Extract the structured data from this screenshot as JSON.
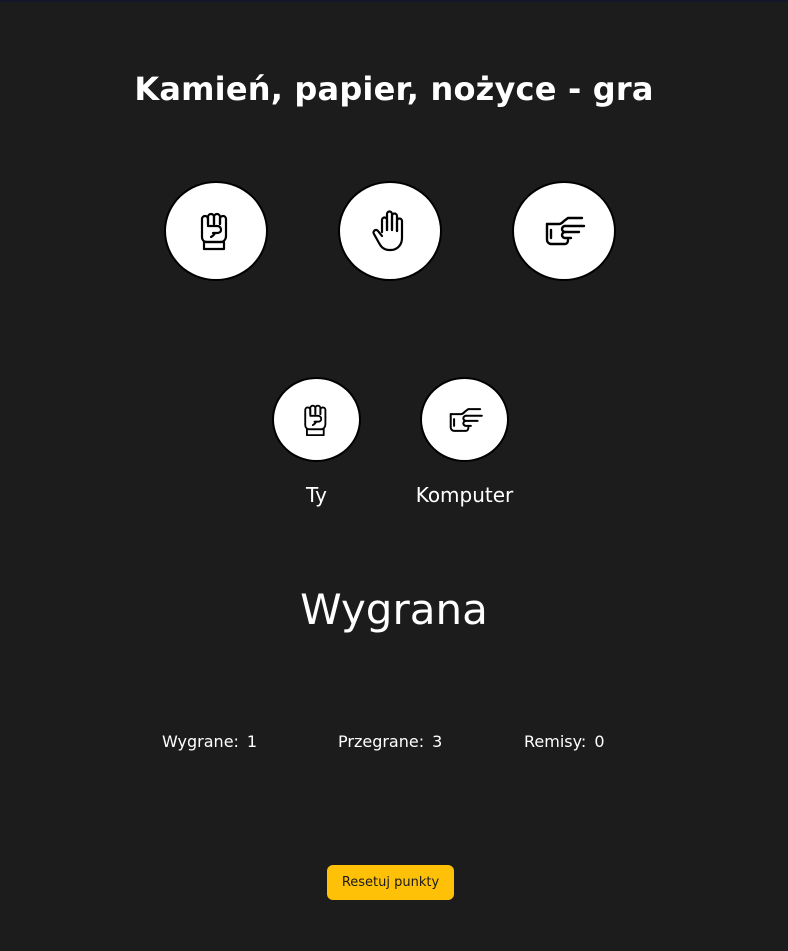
{
  "header": {
    "title": "Kamień, papier, nożyce - gra"
  },
  "choices": [
    {
      "name": "kamień",
      "icon": "fist-icon"
    },
    {
      "name": "papier",
      "icon": "open-hand-icon"
    },
    {
      "name": "nożyce",
      "icon": "scissors-hand-icon"
    }
  ],
  "round": {
    "player_label": "Ty",
    "computer_label": "Komputer",
    "player_icon": "fist-icon",
    "computer_icon": "scissors-hand-icon",
    "outcome": "Wygrana"
  },
  "scores": {
    "wins_label": "Wygrane:",
    "wins": "1",
    "losses_label": "Przegrane:",
    "losses": "3",
    "draws_label": "Remisy:",
    "draws": "0"
  },
  "controls": {
    "reset_label": "Resetuj punkty"
  },
  "colors": {
    "background": "#1c1c1c",
    "accent": "#ffc107",
    "text": "#ffffff"
  }
}
